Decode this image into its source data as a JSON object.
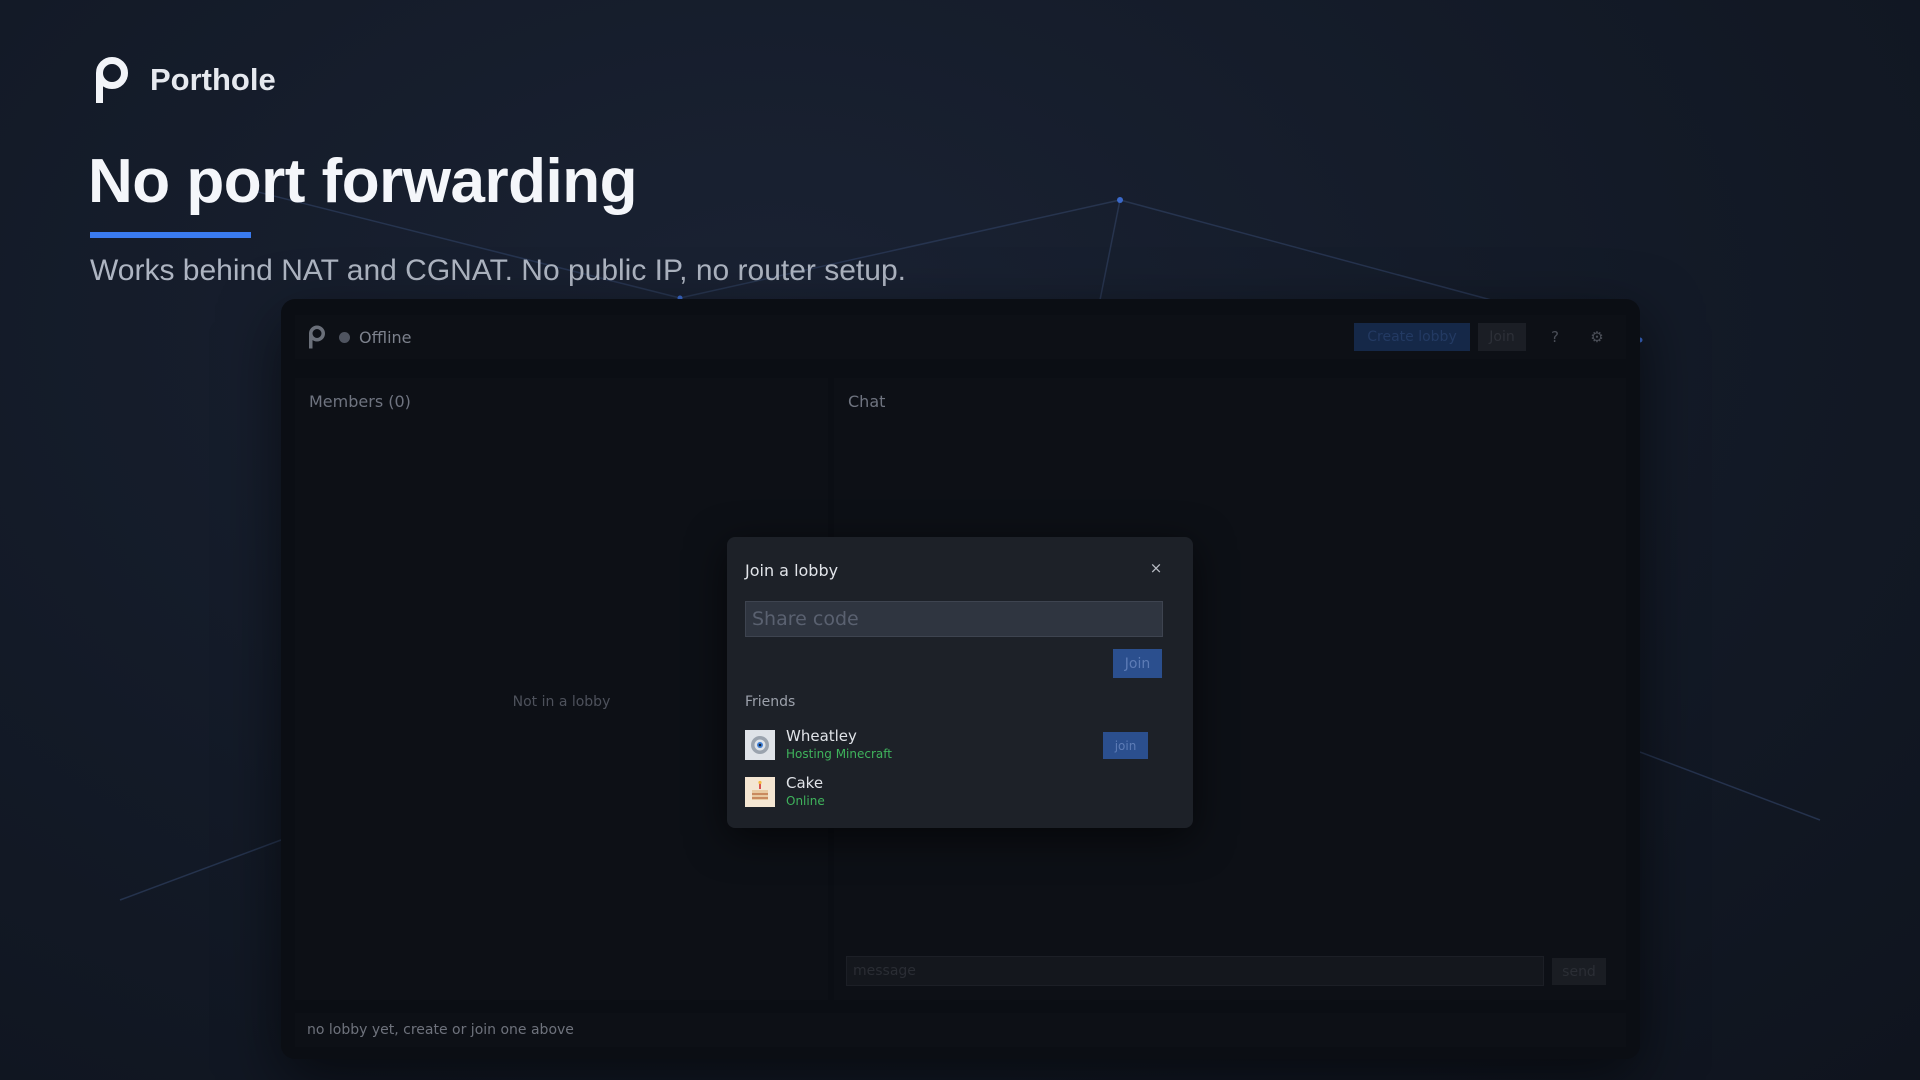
{
  "brand": {
    "name": "Porthole"
  },
  "hero": {
    "headline": "No port forwarding",
    "subline": "Works behind NAT and CGNAT. No public IP, no router setup."
  },
  "app": {
    "status": "Offline",
    "toolbar": {
      "create_label": "Create lobby",
      "join_label": "Join",
      "help_glyph": "?",
      "settings_glyph": "⚙"
    },
    "members": {
      "title": "Members (0)",
      "empty": "Not in a lobby"
    },
    "chat": {
      "title": "Chat",
      "placeholder": "message",
      "send_label": "send"
    },
    "footer": "no lobby yet, create or join one above"
  },
  "modal": {
    "title": "Join a lobby",
    "close_glyph": "×",
    "input_placeholder": "Share code",
    "join_label": "Join",
    "friends_label": "Friends",
    "friends": [
      {
        "name": "Wheatley",
        "status": "Hosting Minecraft",
        "join_label": "join"
      },
      {
        "name": "Cake",
        "status": "Online"
      }
    ]
  },
  "colors": {
    "accent": "#3a7bf0",
    "online": "#3fb35c",
    "button": "#2b4f8e"
  }
}
